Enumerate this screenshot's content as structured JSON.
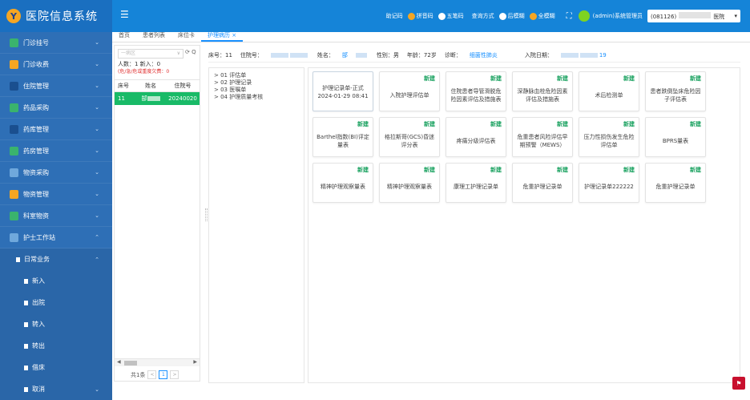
{
  "header": {
    "title": "医院信息系统",
    "logo_glyph": "Y",
    "input_methods_label": "助记码",
    "input_methods": [
      "拼音码",
      "五笔码"
    ],
    "query_label": "查询方式",
    "query_modes": [
      "后模糊",
      "全模糊"
    ],
    "user": "(admin)系统管理员",
    "dept_code": "(081126)",
    "dept_suffix": "医院",
    "colors": {
      "bar": "#1584d8",
      "logo_bg": "#1a6fc0",
      "radio_on": "#f5a623",
      "radio_off": "#ffffff"
    }
  },
  "sidebar": {
    "items": [
      {
        "label": "门诊挂号",
        "icon": "registration-icon",
        "chevron": "⌄",
        "color": "#3ab36d"
      },
      {
        "label": "门诊收费",
        "icon": "cashier-icon",
        "chevron": "⌄",
        "color": "#f5a623"
      },
      {
        "label": "住院管理",
        "icon": "inpatient-icon",
        "chevron": "⌄",
        "color": "#1a4f8f"
      },
      {
        "label": "药品采购",
        "icon": "drug-purchase-icon",
        "chevron": "⌄",
        "color": "#3ab36d"
      },
      {
        "label": "药库管理",
        "icon": "drug-store-icon",
        "chevron": "⌄",
        "color": "#1a4f8f"
      },
      {
        "label": "药房管理",
        "icon": "pharmacy-icon",
        "chevron": "⌄",
        "color": "#3ab36d"
      },
      {
        "label": "物资采购",
        "icon": "material-purchase-icon",
        "chevron": "⌄",
        "color": "#6fa8dc"
      },
      {
        "label": "物资管理",
        "icon": "material-icon",
        "chevron": "⌄",
        "color": "#f5a623"
      },
      {
        "label": "科室物资",
        "icon": "dept-material-icon",
        "chevron": "⌄",
        "color": "#3ab36d"
      },
      {
        "label": "护士工作站",
        "icon": "nurse-station-icon",
        "chevron": "⌃",
        "color": "#6fa8dc"
      }
    ],
    "daily": {
      "label": "日常业务",
      "chevron": "⌃"
    },
    "sub_items": [
      "新入",
      "出院",
      "转入",
      "转出",
      "借床",
      "取消"
    ],
    "last_chevron": "⌄"
  },
  "tabs": [
    "首页",
    "患者列表",
    "床位卡",
    "护理病历"
  ],
  "tab_close": "×",
  "patient_list": {
    "select_placeholder": "一病区",
    "dropdown_glyph": "∨",
    "tool_icons": "⟳ Q",
    "count_text": "人数：1    新入：0",
    "warning": "(危/急/危或重度欠费：0",
    "columns": [
      "床号",
      "姓名",
      "住院号"
    ],
    "rows": [
      {
        "bed": "11",
        "name": "郜",
        "inpatient_no": "20240020"
      }
    ],
    "scroll_left": "◀",
    "scroll_right": "▶",
    "pager_text": "共1条",
    "pager_prev": "<",
    "pager_current": "1",
    "pager_next": ">"
  },
  "patient_info": {
    "bed": "床号：11",
    "inpatient_label": "住院号：",
    "name_label": "姓名：",
    "name_value": "郜",
    "gender": "性别：男",
    "age": "年龄：72岁",
    "diagnosis_label": "诊断：",
    "diagnosis": "细菌性肺炎",
    "admit_label": "入院日期：",
    "admit_suffix": "19"
  },
  "tree": {
    "nodes": [
      "> 01 评估单",
      "> 02 护理记录",
      "> 03 医嘱单",
      "> 04 护理质量考核"
    ]
  },
  "cards": {
    "new_label": "新建",
    "items": [
      {
        "name": "护理记录单-正式 2024-01-29 08:41",
        "is_new": false
      },
      {
        "name": "入院护理评估单",
        "is_new": true
      },
      {
        "name": "住院患者导管滑脱危险因素评估及措施表",
        "is_new": true
      },
      {
        "name": "深静脉血栓危险因素评估及措施表",
        "is_new": true
      },
      {
        "name": "术后检测单",
        "is_new": true
      },
      {
        "name": "患者跌倒坠床危险因子评估表",
        "is_new": true
      },
      {
        "name": "Barthel指数(BI)评定量表",
        "is_new": true
      },
      {
        "name": "格拉斯哥(GCS)昏迷评分表",
        "is_new": true
      },
      {
        "name": "疼痛分级评估表",
        "is_new": true
      },
      {
        "name": "危重患者风险评估早期预警（MEWS）",
        "is_new": true
      },
      {
        "name": "压力性损伤发生危险评估单",
        "is_new": true
      },
      {
        "name": "BPRS量表",
        "is_new": true
      },
      {
        "name": "精神护理观察量表",
        "is_new": true
      },
      {
        "name": "精神护理观察量表",
        "is_new": true
      },
      {
        "name": "康理工护理记录单",
        "is_new": true
      },
      {
        "name": "危重护理记录单",
        "is_new": true
      },
      {
        "name": "护理记录单222222",
        "is_new": true
      },
      {
        "name": "危重护理记录单",
        "is_new": true
      }
    ]
  },
  "corner_button_icon": "flag-icon"
}
